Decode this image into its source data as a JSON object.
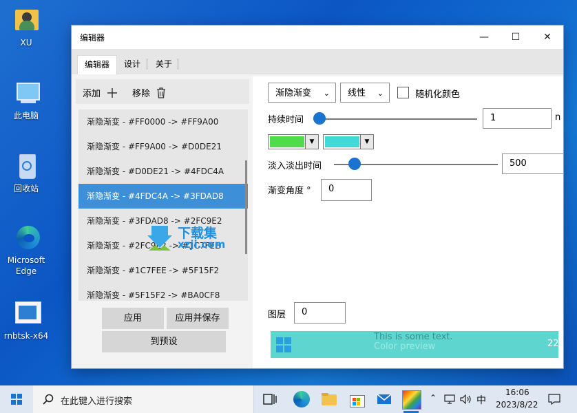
{
  "desktop": {
    "icons": [
      {
        "label": "XU",
        "icon": "user-folder-icon"
      },
      {
        "label": "此电脑",
        "icon": "computer-icon"
      },
      {
        "label": "回收站",
        "icon": "recycle-bin-icon"
      },
      {
        "label": "Microsoft Edge",
        "label_lines": [
          "Microsoft",
          "Edge"
        ],
        "icon": "edge-icon"
      },
      {
        "label": "rnbtsk-x64",
        "icon": "app-window-icon"
      }
    ]
  },
  "window": {
    "title": "编辑器",
    "controls": {
      "minimize": "—",
      "maximize": "☐",
      "close": "✕"
    },
    "tabs": [
      {
        "label": "编辑器",
        "active": true
      },
      {
        "label": "设计",
        "active": false
      },
      {
        "label": "关于",
        "active": false
      }
    ],
    "left": {
      "add_label": "添加",
      "remove_label": "移除",
      "items": [
        "渐隐渐变 - #FF0000 -> #FF9A00",
        "渐隐渐变 - #FF9A00 -> #D0DE21",
        "渐隐渐变 - #D0DE21 -> #4FDC4A",
        "渐隐渐变 - #4FDC4A -> #3FDAD8",
        "渐隐渐变 - #3FDAD8 -> #2FC9E2",
        "渐隐渐变 - #2FC9E2 -> #1C7FEE",
        "渐隐渐变 - #1C7FEE -> #5F15F2",
        "渐隐渐变 - #5F15F2 -> #BA0CF8"
      ],
      "selected_index": 3,
      "apply_label": "应用",
      "apply_save_label": "应用并保存",
      "to_preset_label": "到预设"
    },
    "right": {
      "effect_select": "渐隐渐变",
      "mode_select": "线性",
      "randomize_label": "随机化颜色",
      "randomize_checked": false,
      "duration_label": "持续时间",
      "duration_value": "1",
      "duration_unit": "n",
      "color_from": "#4FDC4A",
      "color_to": "#3FDAD8",
      "fade_label": "淡入淡出时间",
      "fade_value": "500",
      "angle_label": "渐变角度 °",
      "angle_value": "0",
      "layer_label": "图层",
      "layer_value": "0",
      "preview_text": "This is some text.",
      "preview_subtext": "Color preview",
      "preview_number": "22"
    }
  },
  "watermark": {
    "cn": "下载集",
    "en": "xzji.com"
  },
  "taskbar": {
    "search_placeholder": "在此键入进行搜索",
    "ime": "中",
    "time": "16:06",
    "date": "2023/8/22"
  },
  "colors": {
    "selected_item": "#3D8FD8",
    "slider_thumb": "#1A73CF",
    "preview_bg": "#5FD5CF"
  }
}
